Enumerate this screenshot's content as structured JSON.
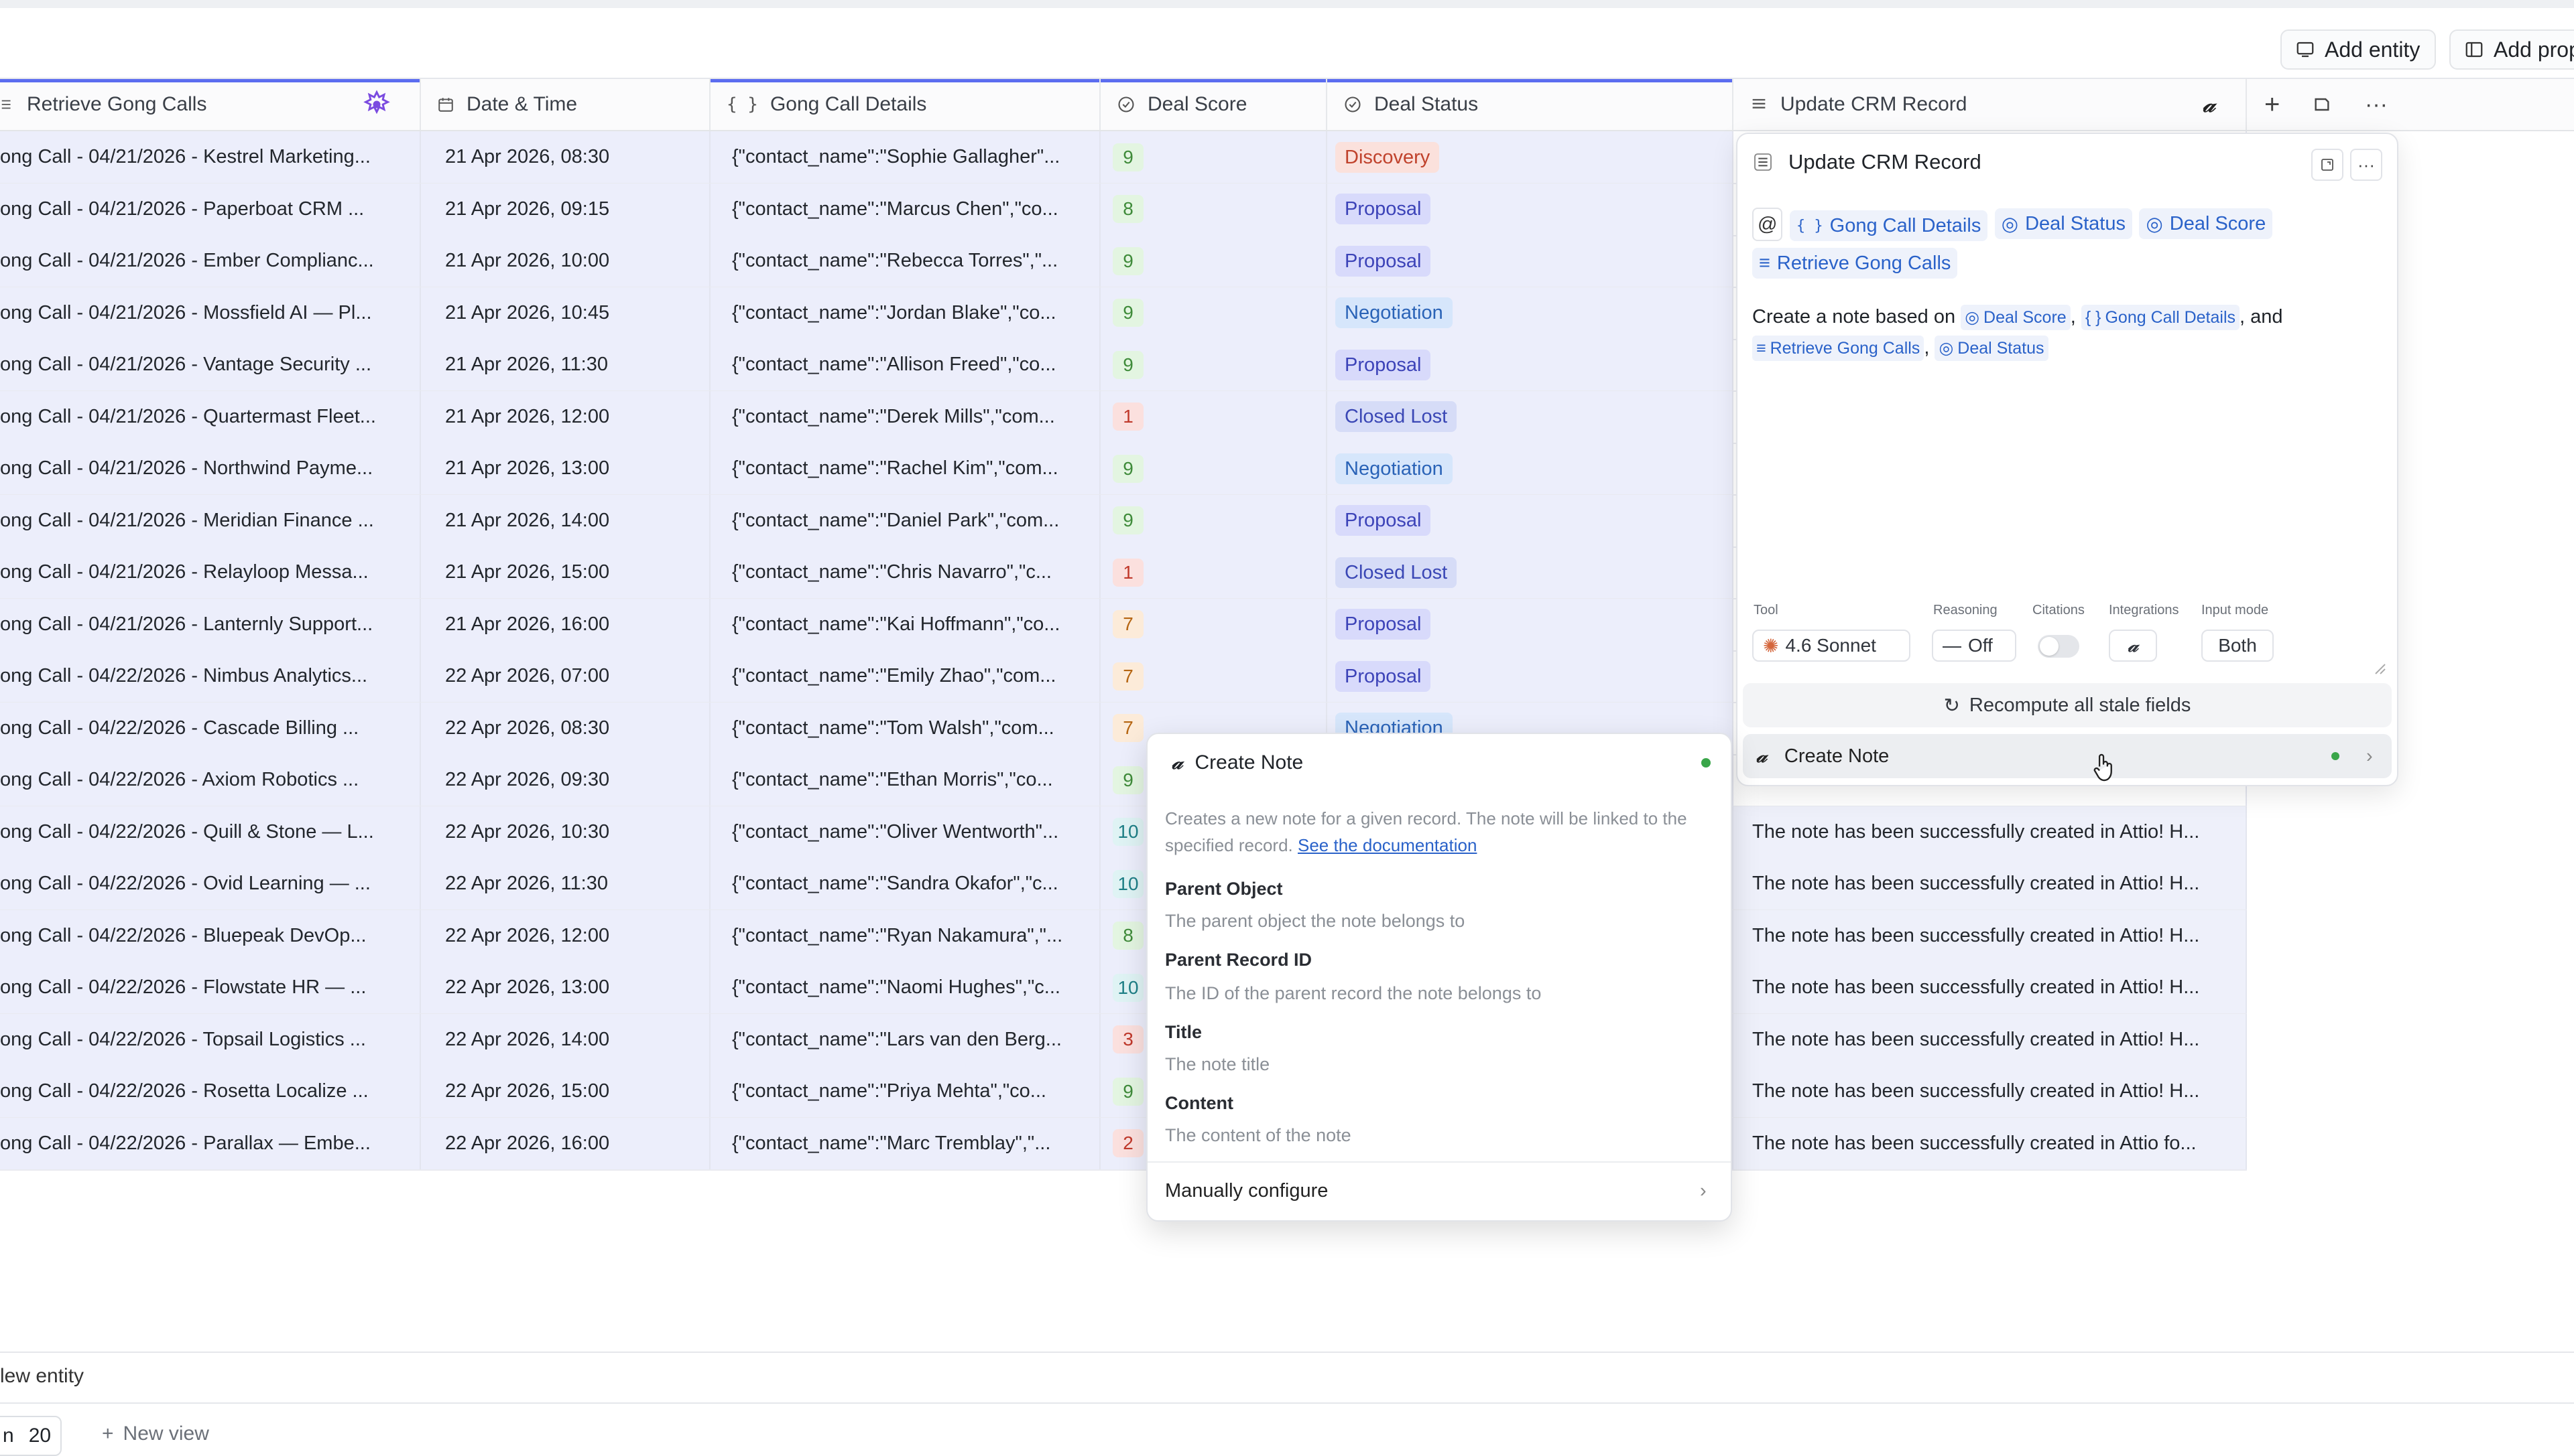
{
  "toolbar": {
    "add_entity": "Add entity",
    "add_property": "Add prop"
  },
  "columns": {
    "retrieve": "Retrieve Gong Calls",
    "datetime": "Date & Time",
    "details": "Gong Call Details",
    "score": "Deal Score",
    "status": "Deal Status",
    "crm": "Update CRM Record"
  },
  "rows": [
    {
      "name": "ong Call - 04/21/2026 - Kestrel Marketing...",
      "dt": "21 Apr 2026, 08:30",
      "details": "{\"contact_name\":\"Sophie Gallagher\"...",
      "score": "9",
      "status": "Discovery"
    },
    {
      "name": "ong Call - 04/21/2026 - Paperboat CRM ...",
      "dt": "21 Apr 2026, 09:15",
      "details": "{\"contact_name\":\"Marcus Chen\",\"co...",
      "score": "8",
      "status": "Proposal"
    },
    {
      "name": "ong Call - 04/21/2026 - Ember Complianc...",
      "dt": "21 Apr 2026, 10:00",
      "details": "{\"contact_name\":\"Rebecca Torres\",\"...",
      "score": "9",
      "status": "Proposal"
    },
    {
      "name": "ong Call - 04/21/2026 - Mossfield AI — Pl...",
      "dt": "21 Apr 2026, 10:45",
      "details": "{\"contact_name\":\"Jordan Blake\",\"co...",
      "score": "9",
      "status": "Negotiation"
    },
    {
      "name": "ong Call - 04/21/2026 - Vantage Security ...",
      "dt": "21 Apr 2026, 11:30",
      "details": "{\"contact_name\":\"Allison Freed\",\"co...",
      "score": "9",
      "status": "Proposal"
    },
    {
      "name": "ong Call - 04/21/2026 - Quartermast Fleet...",
      "dt": "21 Apr 2026, 12:00",
      "details": "{\"contact_name\":\"Derek Mills\",\"com...",
      "score": "1",
      "status": "Closed Lost"
    },
    {
      "name": "ong Call - 04/21/2026 - Northwind Payme...",
      "dt": "21 Apr 2026, 13:00",
      "details": "{\"contact_name\":\"Rachel Kim\",\"com...",
      "score": "9",
      "status": "Negotiation"
    },
    {
      "name": "ong Call - 04/21/2026 - Meridian Finance ...",
      "dt": "21 Apr 2026, 14:00",
      "details": "{\"contact_name\":\"Daniel Park\",\"com...",
      "score": "9",
      "status": "Proposal"
    },
    {
      "name": "ong Call - 04/21/2026 - Relayloop Messa...",
      "dt": "21 Apr 2026, 15:00",
      "details": "{\"contact_name\":\"Chris Navarro\",\"c...",
      "score": "1",
      "status": "Closed Lost"
    },
    {
      "name": "ong Call - 04/21/2026 - Lanternly Support...",
      "dt": "21 Apr 2026, 16:00",
      "details": "{\"contact_name\":\"Kai Hoffmann\",\"co...",
      "score": "7",
      "status": "Proposal"
    },
    {
      "name": "ong Call - 04/22/2026 - Nimbus Analytics...",
      "dt": "22 Apr 2026, 07:00",
      "details": "{\"contact_name\":\"Emily Zhao\",\"com...",
      "score": "7",
      "status": "Proposal"
    },
    {
      "name": "ong Call - 04/22/2026 - Cascade Billing ...",
      "dt": "22 Apr 2026, 08:30",
      "details": "{\"contact_name\":\"Tom Walsh\",\"com...",
      "score": "7",
      "status": "Negotiation"
    },
    {
      "name": "ong Call - 04/22/2026 - Axiom Robotics ...",
      "dt": "22 Apr 2026, 09:30",
      "details": "{\"contact_name\":\"Ethan Morris\",\"co...",
      "score": "9",
      "status": ""
    },
    {
      "name": "ong Call - 04/22/2026 - Quill & Stone — L...",
      "dt": "22 Apr 2026, 10:30",
      "details": "{\"contact_name\":\"Oliver Wentworth\"...",
      "score": "10",
      "status": "",
      "crm": "The note has been successfully created in Attio! H..."
    },
    {
      "name": "ong Call - 04/22/2026 - Ovid Learning — ...",
      "dt": "22 Apr 2026, 11:30",
      "details": "{\"contact_name\":\"Sandra Okafor\",\"c...",
      "score": "10",
      "status": "",
      "crm": "The note has been successfully created in Attio! H..."
    },
    {
      "name": "ong Call - 04/22/2026 - Bluepeak DevOp...",
      "dt": "22 Apr 2026, 12:00",
      "details": "{\"contact_name\":\"Ryan Nakamura\",\"...",
      "score": "8",
      "status": "",
      "crm": "The note has been successfully created in Attio! H..."
    },
    {
      "name": "ong Call - 04/22/2026 - Flowstate HR — ...",
      "dt": "22 Apr 2026, 13:00",
      "details": "{\"contact_name\":\"Naomi Hughes\",\"c...",
      "score": "10",
      "status": "",
      "crm": "The note has been successfully created in Attio! H..."
    },
    {
      "name": "ong Call - 04/22/2026 - Topsail Logistics ...",
      "dt": "22 Apr 2026, 14:00",
      "details": "{\"contact_name\":\"Lars van den Berg...",
      "score": "3",
      "status": "",
      "crm": "The note has been successfully created in Attio! H..."
    },
    {
      "name": "ong Call - 04/22/2026 - Rosetta Localize ...",
      "dt": "22 Apr 2026, 15:00",
      "details": "{\"contact_name\":\"Priya Mehta\",\"co...",
      "score": "9",
      "status": "",
      "crm": "The note has been successfully created in Attio! H..."
    },
    {
      "name": "ong Call - 04/22/2026 - Parallax — Embe...",
      "dt": "22 Apr 2026, 16:00",
      "details": "{\"contact_name\":\"Marc Tremblay\",\"...",
      "score": "2",
      "status": "",
      "crm": "The note has been successfully created in Attio fo..."
    }
  ],
  "panel": {
    "title": "Update CRM Record",
    "chips": [
      "Gong Call Details",
      "Deal Status",
      "Deal Score",
      "Retrieve Gong Calls"
    ],
    "prompt_prefix": "Create a note based on",
    "prompt_comma": ",",
    "prompt_and": ", and",
    "prompt_refs": [
      "Deal Score",
      "Gong Call Details",
      "Retrieve Gong Calls",
      "Deal Status"
    ],
    "tool_label": "Tool",
    "tool_value": "4.6 Sonnet",
    "reasoning_label": "Reasoning",
    "reasoning_value": "Off",
    "citations_label": "Citations",
    "integrations_label": "Integrations",
    "input_mode_label": "Input mode",
    "input_mode_value": "Both",
    "recompute": "Recompute all stale fields",
    "integration_item": "Create Note"
  },
  "popup": {
    "title": "Create Note",
    "description": "Creates a new note for a given record. The note will be linked to the specified record.",
    "doc_link": "See the documentation",
    "fields": [
      {
        "name": "Parent Object",
        "desc": "The parent object the note belongs to"
      },
      {
        "name": "Parent Record ID",
        "desc": "The ID of the parent record the note belongs to"
      },
      {
        "name": "Title",
        "desc": "The note title"
      },
      {
        "name": "Content",
        "desc": "The content of the note"
      }
    ],
    "manual": "Manually configure"
  },
  "footer": {
    "new_entity": "lew entity",
    "count": "20",
    "new_view": "New view",
    "view_prefix": "n"
  },
  "colors": {
    "accent": "#5b6cf0",
    "status_green": "#3aa64a"
  }
}
